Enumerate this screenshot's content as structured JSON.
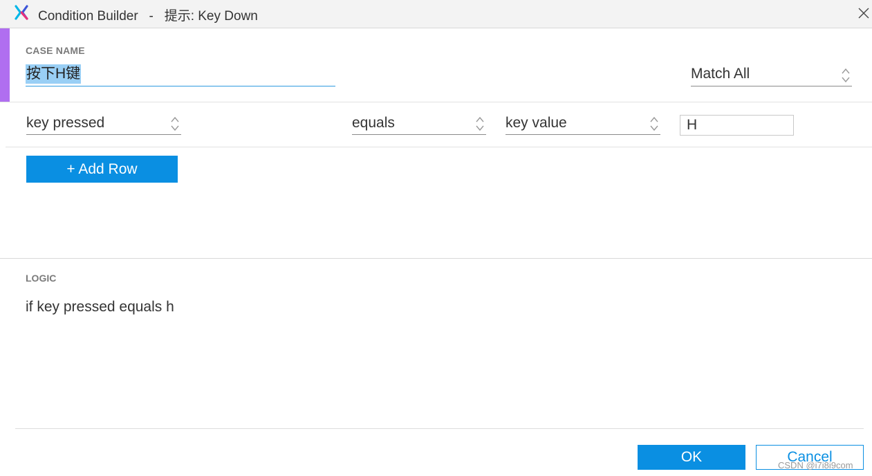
{
  "window": {
    "title": "Condition Builder   -   提示: Key Down"
  },
  "case": {
    "label": "CASE NAME",
    "name_value": "按下H键",
    "match_mode": "Match All"
  },
  "condition_row": {
    "target": "key pressed",
    "operator": "equals",
    "value_type": "key value",
    "value": "H"
  },
  "add_row_label": "+ Add Row",
  "logic": {
    "label": "LOGIC",
    "text": "if key pressed equals h"
  },
  "footer": {
    "ok_label": "OK",
    "cancel_label": "Cancel",
    "watermark": "CSDN @i7i8i9com"
  },
  "colors": {
    "accent": "#b06ef0",
    "primary": "#0a8fe2",
    "selection": "#99cff5"
  },
  "icons": {
    "app": "axure-x-logo",
    "close": "close-icon",
    "select": "up-down-chevron-icon"
  }
}
